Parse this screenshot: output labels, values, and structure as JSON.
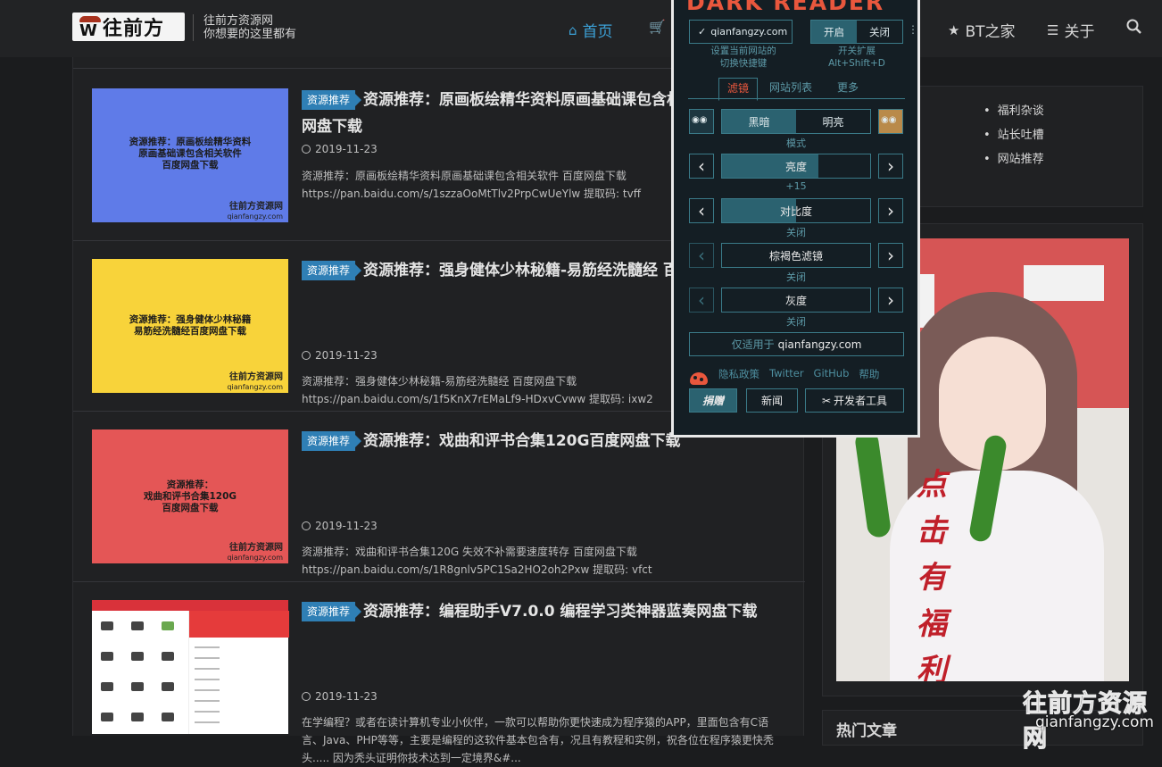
{
  "header": {
    "logo_text": "往前方",
    "logo_mark": "W",
    "tagline_line1": "往前方资源网",
    "tagline_line2": "你想要的这里都有",
    "nav": [
      {
        "label": "首页",
        "icon": "home-icon",
        "active": true
      },
      {
        "label": "BT之家",
        "icon": "star-icon"
      },
      {
        "label": "关于",
        "icon": "list-icon"
      }
    ]
  },
  "posts": [
    {
      "badge": "资源推荐",
      "title_line1": "资源推荐：原画板绘精华资料原画基础课包含相关软件 百度",
      "title_line2": "网盘下载",
      "date": "2019-11-23",
      "excerpt_line1": "资源推荐：原画板绘精华资料原画基础课包含相关软件 百度网盘下载",
      "excerpt_line2": "https://pan.baidu.com/s/1szzaOoMtTlv2PrpCwUeYlw 提取码: tvff",
      "excerpt_line3": "",
      "thumb_title": "资源推荐：原画板绘精华资料\n原画基础课包含相关软件\n百度网盘下载",
      "thumb_color": "#5f7be8",
      "thumb_wm1": "往前方资源网",
      "thumb_wm2": "qianfangzy.com"
    },
    {
      "badge": "资源推荐",
      "title_line1": "资源推荐：强身健体少林秘籍-易筋经洗髓经 百度网盘下载",
      "title_line2": "",
      "date": "2019-11-23",
      "excerpt_line1": "资源推荐：强身健体少林秘籍-易筋经洗髓经 百度网盘下载",
      "excerpt_line2": "https://pan.baidu.com/s/1f5KnX7rEMaLf9-HDxvCvww 提取码: ixw2",
      "excerpt_line3": "",
      "thumb_title": "资源推荐：强身健体少林秘籍\n易筋经洗髓经百度网盘下载",
      "thumb_color": "#f8d33a",
      "thumb_wm1": "往前方资源网",
      "thumb_wm2": "qianfangzy.com"
    },
    {
      "badge": "资源推荐",
      "title_line1": "资源推荐：戏曲和评书合集120G百度网盘下载",
      "title_line2": "",
      "date": "2019-11-23",
      "excerpt_line1": "资源推荐：戏曲和评书合集120G  失效不补需要速度转存 百度网盘下载",
      "excerpt_line2": "https://pan.baidu.com/s/1R8gnlv5PC1Sa2HO2oh2Pxw  提取码: vfct",
      "excerpt_line3": "",
      "thumb_title": "资源推荐：\n戏曲和评书合集120G\n百度网盘下载",
      "thumb_color": "#e45656",
      "thumb_wm1": "往前方资源网",
      "thumb_wm2": "qianfangzy.com"
    },
    {
      "badge": "资源推荐",
      "title_line1": "资源推荐：编程助手V7.0.0 编程学习类神器蓝奏网盘下载",
      "title_line2": "",
      "date": "2019-11-23",
      "excerpt_line1": "在学编程？或者在读计算机专业小伙伴，一款可以帮助你更快速成为程序猿的APP，里面包含有C语",
      "excerpt_line2": "言、Java、PHP等等，主要是编程的这软件基本包含有，况且有教程和实例，祝各位在程序猿更快秃",
      "excerpt_line3": "头..... 因为秃头证明你技术达到一定境界&#...",
      "thumb_title": "",
      "thumb_color": "#ffffff",
      "thumb_wm1": "",
      "thumb_wm2": ""
    }
  ],
  "sidebar": {
    "links": [
      "福利杂谈",
      "站长吐槽",
      "网站推荐"
    ],
    "ad_text": "点击有福利",
    "hot_title": "热门文章"
  },
  "watermark": {
    "name": "往前方资源网",
    "url": "qianfangzy.com"
  },
  "dark_reader": {
    "title": "DARK READER",
    "site_button": "qianfangzy.com",
    "toggle_on": "开启",
    "toggle_off": "关闭",
    "hint_site": "设置当前网站的\n切换快捷键",
    "hint_toggle": "开关扩展\nAlt+Shift+D",
    "tabs": [
      "滤镜",
      "网站列表",
      "更多"
    ],
    "mode_dark": "黑暗",
    "mode_light": "明亮",
    "mode_label": "模式",
    "brightness_label": "亮度",
    "brightness_value": "+15",
    "brightness_level": 0.65,
    "contrast_label": "对比度",
    "contrast_value": "关闭",
    "contrast_level": 0.5,
    "sepia_label": "棕褐色滤镜",
    "sepia_value": "关闭",
    "grayscale_label": "灰度",
    "grayscale_value": "关闭",
    "only_for_prefix": "仅适用于",
    "only_for_site": "qianfangzy.com",
    "links": [
      "隐私政策",
      "Twitter",
      "GitHub",
      "帮助"
    ],
    "donate": "捐赠",
    "news": "新闻",
    "devtools": "开发者工具",
    "accent": "#e9573d",
    "primary": "#2b6270"
  }
}
